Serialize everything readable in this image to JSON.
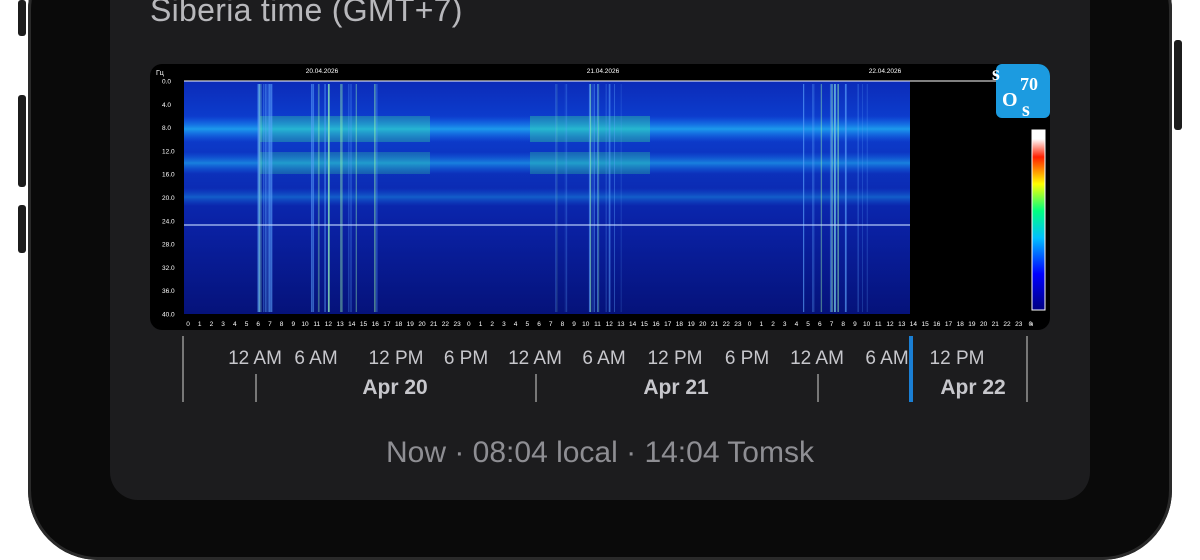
{
  "header": {
    "title": "Siberia time (GMT+7)"
  },
  "spectrogram": {
    "unit_label": "Гц",
    "hour_unit_label": "ч",
    "freq_labels": [
      "0.0",
      "4.0",
      "8.0",
      "12.0",
      "16.0",
      "20.0",
      "24.0",
      "28.0",
      "32.0",
      "36.0",
      "40.0"
    ],
    "date_labels": [
      "20.04.2026",
      "21.04.2026",
      "22.04.2026"
    ],
    "logo": {
      "top": "s",
      "num": "70",
      "mid": "O",
      "bot": "s"
    },
    "logo_color": "#1c9be0"
  },
  "timeline": {
    "time_labels": [
      "12 AM",
      "6 AM",
      "12 PM",
      "6 PM",
      "12 AM",
      "6 AM",
      "12 PM",
      "6 PM",
      "12 AM",
      "6 AM",
      "12 PM"
    ],
    "date_labels": [
      "Apr 20",
      "Apr 21",
      "Apr 22"
    ],
    "now_color": "#1a7fd4"
  },
  "status": {
    "now_text": "Now · 08:04 local · 14:04 Tomsk"
  }
}
